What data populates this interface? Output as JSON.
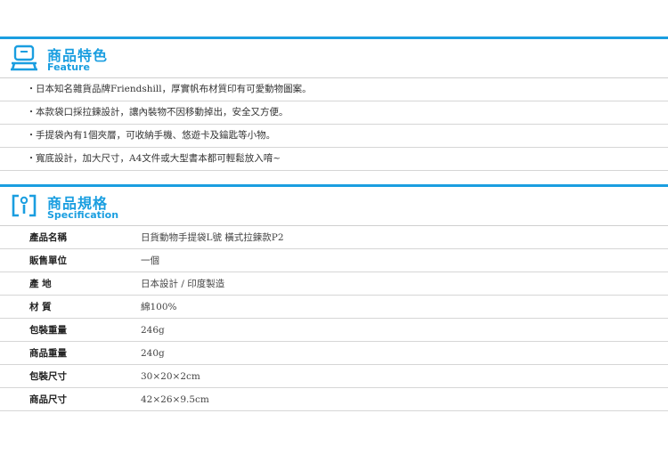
{
  "feature": {
    "title_zh": "商品特色",
    "title_en": "Feature",
    "items": [
      "日本知名雜貨品牌Friendshill，厚實帆布材質印有可愛動物圖案。",
      "本款袋口採拉鍊設計，讓內裝物不因移動掉出，安全又方便。",
      "手提袋內有1個夾層，可收納手機、悠遊卡及鑰匙等小物。",
      "寬底設計，加大尺寸，A4文件或大型書本都可輕鬆放入唷~"
    ],
    "bullet": "・"
  },
  "spec": {
    "title_zh": "商品規格",
    "title_en": "Specification",
    "rows": [
      {
        "label": "產品名稱",
        "value": "日貨動物手提袋L號 橫式拉鍊款P2"
      },
      {
        "label": "販售單位",
        "value": "一個"
      },
      {
        "label": "產 地",
        "value": "日本設計 / 印度製造"
      },
      {
        "label": "材 質",
        "value": "綿100%"
      },
      {
        "label": "包裝重量",
        "value": "246g"
      },
      {
        "label": "商品重量",
        "value": "240g"
      },
      {
        "label": "包裝尺寸",
        "value": "30×20×2cm"
      },
      {
        "label": "商品尺寸",
        "value": "42×26×9.5cm"
      }
    ]
  },
  "colors": {
    "accent": "#1a9ee0",
    "text": "#333333",
    "rule": "#d6d6d6"
  },
  "icons": {
    "feature": "display-stand-icon",
    "spec": "bracket-frame-icon"
  }
}
